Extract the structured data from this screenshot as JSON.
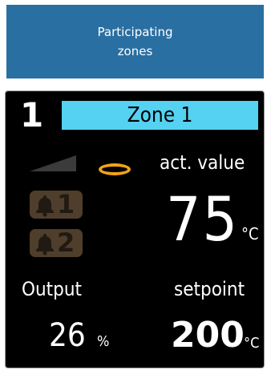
{
  "header": {
    "button_line1": "Participating",
    "button_line2": "zones",
    "bg_color": "#2a6fa1"
  },
  "zone": {
    "number": "1",
    "name": "Zone 1",
    "name_bg_color": "#55d2f1",
    "icons": {
      "ramp": "ramp-icon",
      "status": "ring-icon",
      "alarm1": "bell-alarm-1-icon",
      "alarm2": "bell-alarm-2-icon"
    },
    "alarm1_label": "1",
    "alarm2_label": "2",
    "actual": {
      "label": "act. value",
      "value": "75",
      "unit": "°C"
    },
    "output": {
      "label": "Output",
      "value": "26",
      "unit": "%"
    },
    "setpoint": {
      "label": "setpoint",
      "value": "200",
      "unit": "°C"
    },
    "status_color": "#f3a316",
    "alarm_color": "#4e3e2b"
  }
}
